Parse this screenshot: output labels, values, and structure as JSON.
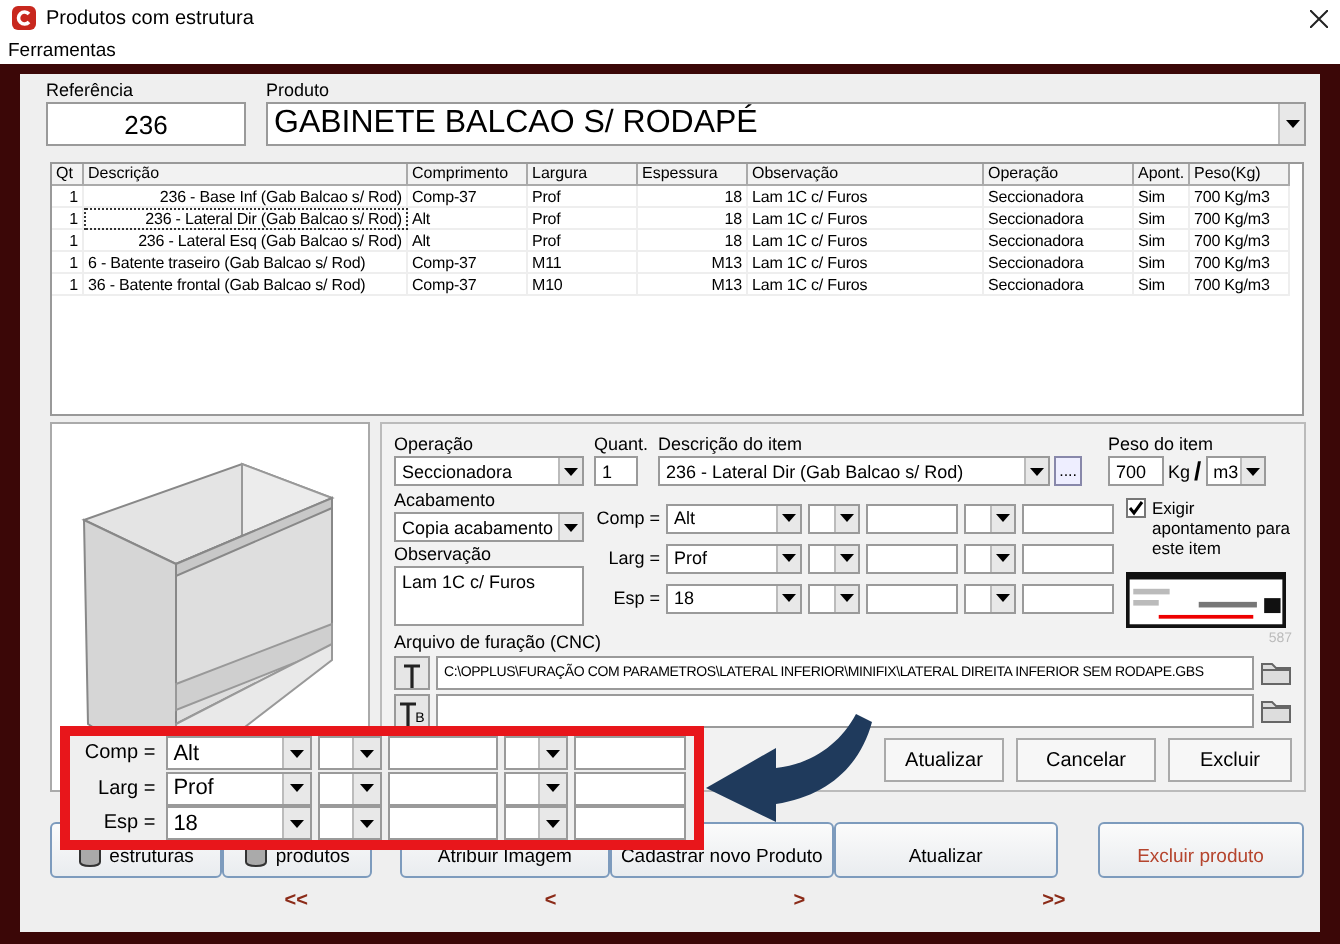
{
  "window": {
    "title": "Produtos com estrutura"
  },
  "menu": [
    {
      "label": "Ferramentas"
    }
  ],
  "referencia": {
    "label": "Referência",
    "value": "236"
  },
  "produto": {
    "label": "Produto",
    "value": "GABINETE BALCAO S/ RODAPÉ"
  },
  "table": {
    "columns": [
      "Qt",
      "Descrição",
      "Comprimento",
      "Largura",
      "Espessura",
      "Observação",
      "Operação",
      "Apont.",
      "Peso(Kg)"
    ],
    "rows": [
      {
        "cells": [
          "1",
          "236 - Base Inf (Gab Balcao s/ Rod)",
          "Comp-37",
          "Prof",
          "18",
          "Lam 1C c/ Furos",
          "Seccionadora",
          "Sim",
          "700 Kg/m3"
        ],
        "selected": false
      },
      {
        "cells": [
          "1",
          "236 - Lateral Dir (Gab Balcao s/ Rod)",
          "Alt",
          "Prof",
          "18",
          "Lam 1C c/ Furos",
          "Seccionadora",
          "Sim",
          "700 Kg/m3"
        ],
        "selected": true
      },
      {
        "cells": [
          "1",
          "236 - Lateral Esq (Gab Balcao s/ Rod)",
          "Alt",
          "Prof",
          "18",
          "Lam 1C c/ Furos",
          "Seccionadora",
          "Sim",
          "700 Kg/m3"
        ],
        "selected": false
      },
      {
        "cells": [
          "1",
          "6 - Batente traseiro (Gab Balcao s/ Rod)",
          "Comp-37",
          "M11",
          "M13",
          "Lam 1C c/ Furos",
          "Seccionadora",
          "Sim",
          "700 Kg/m3"
        ],
        "selected": false
      },
      {
        "cells": [
          "1",
          "36 - Batente frontal (Gab Balcao s/ Rod)",
          "Comp-37",
          "M10",
          "M13",
          "Lam 1C c/ Furos",
          "Seccionadora",
          "Sim",
          "700 Kg/m3"
        ],
        "selected": false
      }
    ]
  },
  "item_form": {
    "operacao": {
      "label": "Operação",
      "value": "Seccionadora"
    },
    "quant": {
      "label": "Quant.",
      "value": "1"
    },
    "descricao": {
      "label": "Descrição do item",
      "value": "236 - Lateral Dir (Gab Balcao s/ Rod)",
      "button": "...."
    },
    "peso": {
      "label": "Peso do item",
      "value": "700",
      "unit": "Kg",
      "separator": "/",
      "per": "m3"
    },
    "acabamento": {
      "label": "Acabamento",
      "value": "Copia acabamento"
    },
    "observacao": {
      "label": "Observação",
      "value": "Lam 1C c/ Furos"
    },
    "formulas": [
      {
        "label": "Comp =",
        "value": "Alt"
      },
      {
        "label": "Larg =",
        "value": "Prof"
      },
      {
        "label": "Esp =",
        "value": "18"
      }
    ],
    "exigir": {
      "label": "Exigir apontamento para este item",
      "checked": true
    },
    "arquivo": {
      "label": "Arquivo de furação (CNC)",
      "code": "587",
      "path": "C:\\OPPLUS\\FURAÇÃO COM PARAMETROS\\LATERAL INFERIOR\\MINIFIX\\LATERAL DIREITA INFERIOR SEM RODAPE.GBS",
      "marker_b": "B"
    },
    "buttons": [
      "Atualizar",
      "Cancelar",
      "Excluir"
    ]
  },
  "bottom_buttons": [
    {
      "label": "estruturas",
      "kind": "database"
    },
    {
      "label": "produtos",
      "kind": "database"
    },
    {
      "label": "Atribuir Imagem",
      "kind": "plain"
    },
    {
      "label": "Cadastrar novo Produto",
      "kind": "plain"
    },
    {
      "label": "Atualizar",
      "kind": "plain"
    },
    {
      "label": "Excluir produto",
      "kind": "danger"
    }
  ],
  "nav": [
    "<<",
    "<",
    ">",
    ">>"
  ],
  "magnified": {
    "formulas": [
      {
        "label": "Comp =",
        "value": "Alt"
      },
      {
        "label": "Larg =",
        "value": "Prof"
      },
      {
        "label": "Esp =",
        "value": "18"
      }
    ]
  }
}
